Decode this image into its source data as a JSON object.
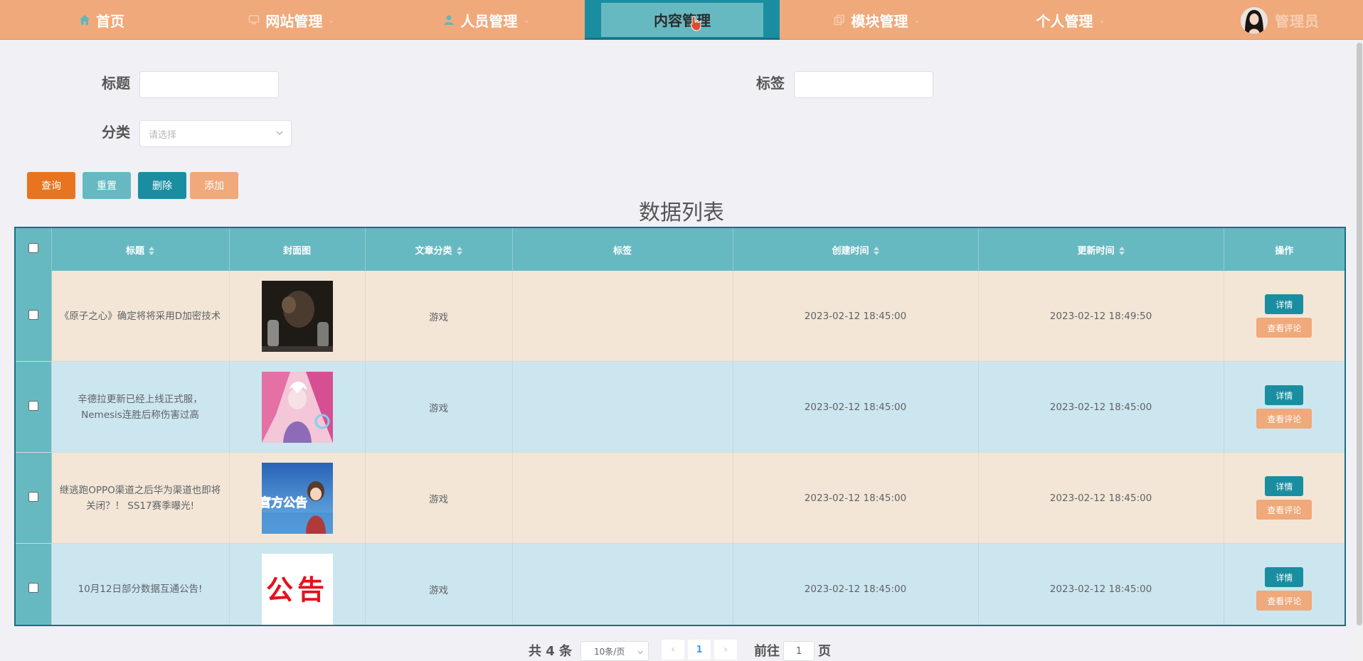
{
  "nav": {
    "items": [
      {
        "label": "首页",
        "icon": "home-icon",
        "caret": false,
        "active": false
      },
      {
        "label": "网站管理",
        "icon": "monitor-icon",
        "caret": true,
        "active": false
      },
      {
        "label": "人员管理",
        "icon": "user-icon",
        "caret": true,
        "active": false
      },
      {
        "label": "内容管理",
        "icon": "",
        "caret": false,
        "active": true
      },
      {
        "label": "模块管理",
        "icon": "copy-icon",
        "caret": true,
        "active": false
      },
      {
        "label": "个人管理",
        "icon": "",
        "caret": true,
        "active": false
      }
    ],
    "caret_glyph": "⌄",
    "username": "管理员"
  },
  "search": {
    "title_label": "标题",
    "title_value": "",
    "tag_label": "标签",
    "tag_value": "",
    "category_label": "分类",
    "category_placeholder": "请选择"
  },
  "buttons": {
    "query": "查询",
    "reset": "重置",
    "delete": "删除",
    "add": "添加"
  },
  "colors": {
    "nav_bg": "#efa97a",
    "nav_active": "#1a8ea0",
    "table_header": "#67b9c1",
    "row_odd": "#f3e6d7",
    "row_even": "#cce6f0",
    "btn_query": "#e8741f",
    "btn_reset": "#67b9c1",
    "btn_delete": "#1a8ea0",
    "btn_add": "#efa97a"
  },
  "table": {
    "heading": "数据列表",
    "columns": [
      "标题",
      "封面图",
      "文章分类",
      "标签",
      "创建时间",
      "更新时间",
      "操作"
    ],
    "detail_label": "详情",
    "comment_label": "查看评论",
    "rows": [
      {
        "title": "《原子之心》确定将将采用D加密技术",
        "cover": "dark-scene-image",
        "category": "游戏",
        "tag": "",
        "created": "2023-02-12 18:45:00",
        "updated": "2023-02-12 18:49:50"
      },
      {
        "title": "辛德拉更新已经上线正式服，Nemesis连胜后称伤害过高",
        "cover": "anime-character-image",
        "category": "游戏",
        "tag": "",
        "created": "2023-02-12 18:45:00",
        "updated": "2023-02-12 18:45:00"
      },
      {
        "title": "继逃跑OPPO渠道之后华为渠道也即将关闭？！ SS17赛季曝光!",
        "cover": "official-notice-image",
        "category": "游戏",
        "tag": "",
        "created": "2023-02-12 18:45:00",
        "updated": "2023-02-12 18:45:00"
      },
      {
        "title": "10月12日部分数据互通公告!",
        "cover": "notice-text-image",
        "category": "游戏",
        "tag": "",
        "created": "2023-02-12 18:45:00",
        "updated": "2023-02-12 18:45:00"
      }
    ]
  },
  "cover_texts": {
    "official_notice": "官方公告",
    "notice": "公告"
  },
  "pagination": {
    "total": "共 4 条",
    "page_size": "10条/页",
    "prev": "‹",
    "current": "1",
    "next": "›",
    "goto_label": "前往",
    "goto_value": "1",
    "page_suffix": "页"
  }
}
